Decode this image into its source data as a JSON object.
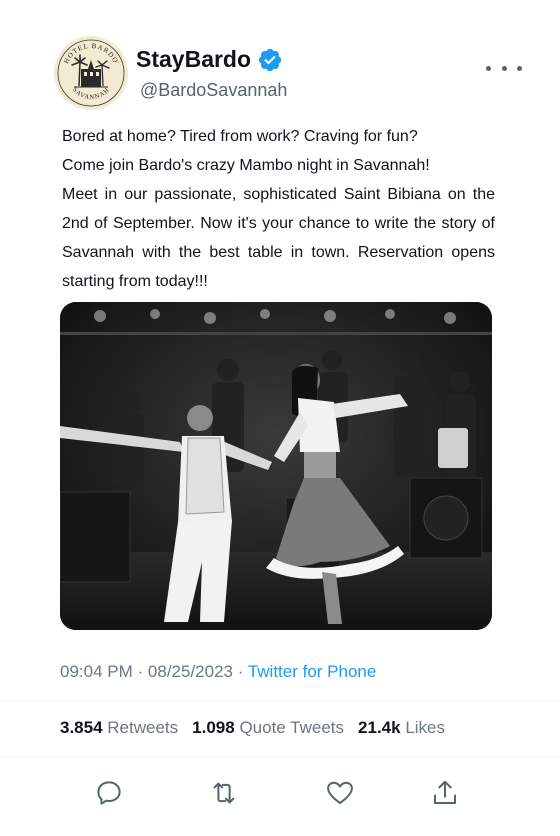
{
  "profile": {
    "display_name": "StayBardo",
    "handle": "@BardoSavannah",
    "avatar_text_top": "HOTEL BARDO",
    "avatar_text_bottom": "SAVANNAH",
    "verified_icon": "verified-badge-icon",
    "more_icon": "more-options-icon"
  },
  "tweet": {
    "line1": "Bored at home? Tired from work? Craving for fun?",
    "line2": "Come join Bardo's crazy Mambo night in Savannah!",
    "line3": "Meet in our passionate, sophisticated Saint Bibiana on the 2nd of September. Now it's your chance to write the story of Savannah with the best table in town. Reservation opens starting from today!!!"
  },
  "photo": {
    "subject": "black-and-white photo of a couple dancing mambo in front of a live band"
  },
  "meta": {
    "time": "09:04 PM",
    "separator": "·",
    "date": "08/25/2023",
    "source": "Twitter for Phone"
  },
  "stats": {
    "retweets_count": "3.854",
    "retweets_label": "Retweets",
    "quotes_count": "1.098",
    "quotes_label": "Quote Tweets",
    "likes_count": "21.4k",
    "likes_label": "Likes"
  },
  "actions": [
    "reply-icon",
    "retweet-icon",
    "like-icon",
    "share-icon"
  ],
  "colors": {
    "accent": "#1d9bf0",
    "muted": "#6b7785",
    "text": "#0f1419"
  }
}
